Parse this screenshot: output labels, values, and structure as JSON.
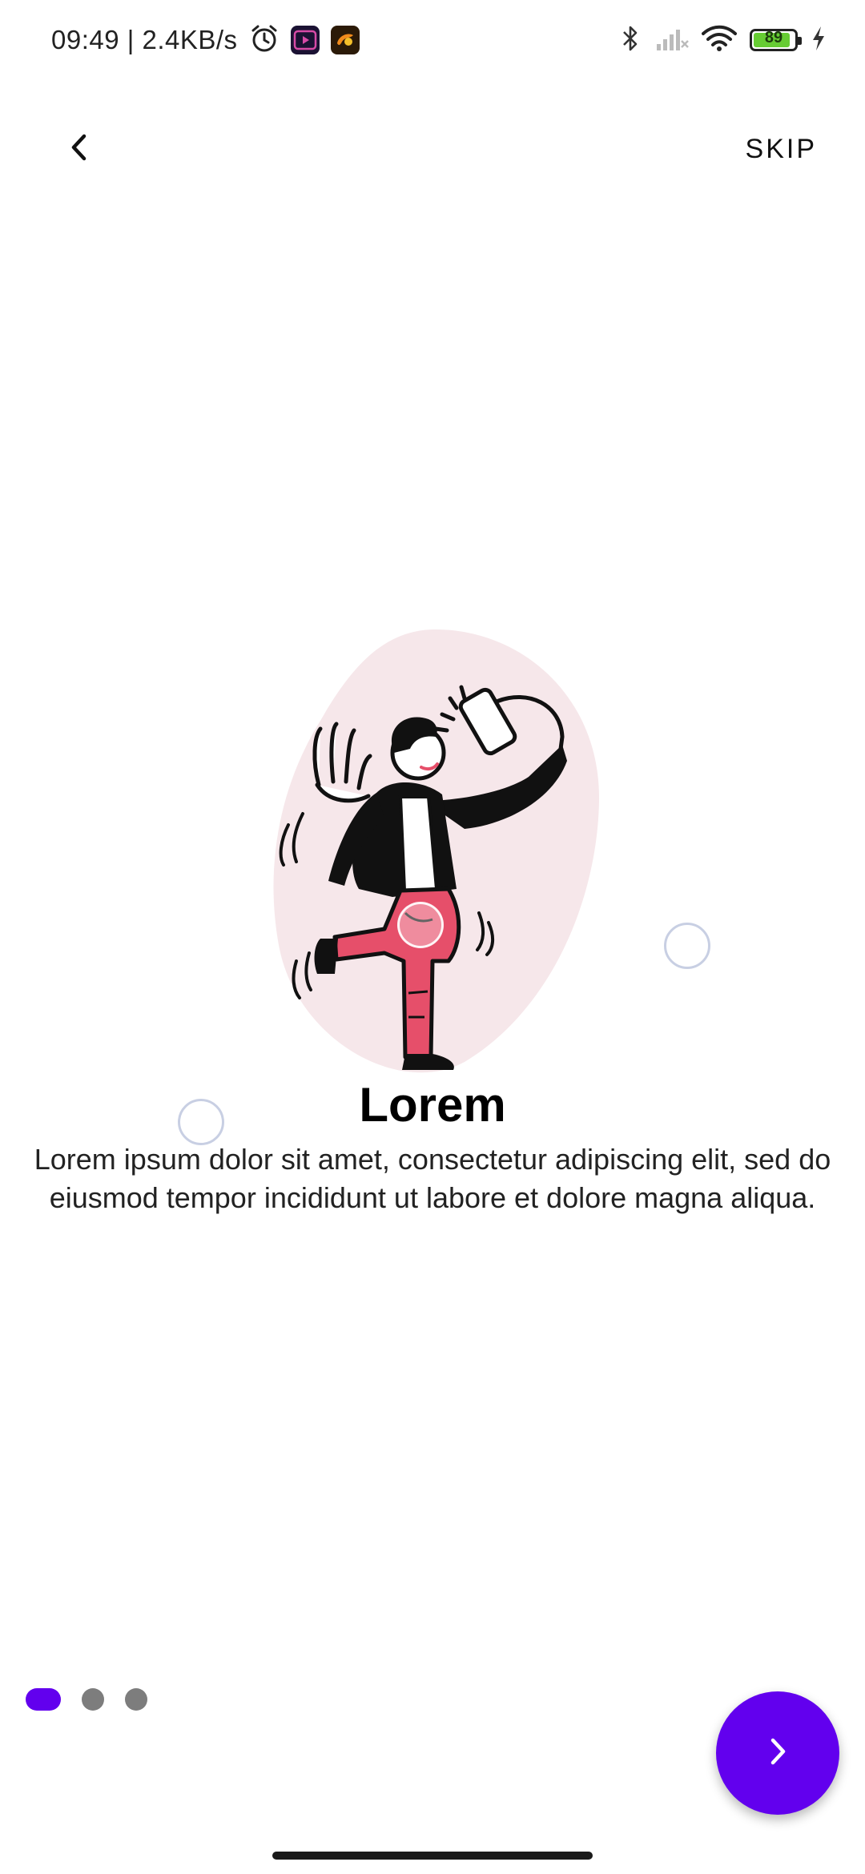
{
  "status_bar": {
    "time_speed": "09:49 | 2.4KB/s",
    "battery_level": "89",
    "icons": [
      "alarm-icon",
      "video-app-icon",
      "app-icon",
      "bluetooth-icon",
      "cellular-signal-icon",
      "wifi-icon",
      "battery-icon",
      "charging-icon"
    ]
  },
  "top_bar": {
    "back_icon": "chevron-left-icon",
    "skip_label": "SKIP"
  },
  "content": {
    "title": "Lorem",
    "description": "Lorem ipsum dolor sit amet, consectetur adipiscing elit, sed do eiusmod tempor incididunt ut labore et dolore magna aliqua."
  },
  "pager": {
    "page_count": 3,
    "current_page": 1
  },
  "next_button": {
    "icon": "chevron-right-icon"
  },
  "colors": {
    "accent": "#6200ee",
    "illustration_blob": "#f6e7ea",
    "pants": "#e64f6a",
    "inactive_dot": "#7d7d7d"
  }
}
